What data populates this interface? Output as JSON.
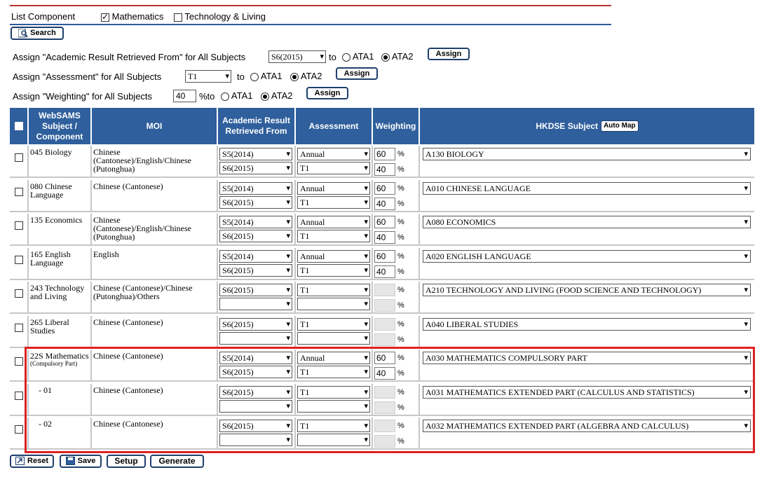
{
  "top": {
    "title": "List Component",
    "opt1": "Mathematics",
    "opt2": "Technology & Living",
    "search": "Search"
  },
  "assign": {
    "row1_label": "Assign \"Academic Result Retrieved From\" for All Subjects",
    "row1_select": "S6(2015)",
    "row2_label": "Assign \"Assessment\" for All Subjects",
    "row2_select": "T1",
    "row3_label": "Assign \"Weighting\" for All Subjects",
    "row3_value": "40",
    "to": "to",
    "pct_to": "%to",
    "ata1": "ATA1",
    "ata2": "ATA2",
    "assign_btn": "Assign"
  },
  "table": {
    "headers": {
      "subject": "WebSAMS Subject / Component",
      "moi": "MOI",
      "academic": "Academic Result Retrieved From",
      "assessment": "Assessment",
      "weighting": "Weighting",
      "hkdse": "HKDSE Subject",
      "automap": "Auto Map"
    },
    "rows": [
      {
        "subject": "045 Biology",
        "moi": "Chinese (Cantonese)/English/Chinese (Putonghua)",
        "ar1": "S5(2014)",
        "ar2": "S6(2015)",
        "as1": "Annual",
        "as2": "T1",
        "w1": "60",
        "w2": "40",
        "hk": "A130 BIOLOGY"
      },
      {
        "subject": "080 Chinese Language",
        "moi": "Chinese (Cantonese)",
        "ar1": "S5(2014)",
        "ar2": "S6(2015)",
        "as1": "Annual",
        "as2": "T1",
        "w1": "60",
        "w2": "40",
        "hk": "A010 CHINESE LANGUAGE"
      },
      {
        "subject": "135 Economics",
        "moi": "Chinese (Cantonese)/English/Chinese (Putonghua)",
        "ar1": "S5(2014)",
        "ar2": "S6(2015)",
        "as1": "Annual",
        "as2": "T1",
        "w1": "60",
        "w2": "40",
        "hk": "A080 ECONOMICS"
      },
      {
        "subject": "165 English Language",
        "moi": "English",
        "ar1": "S5(2014)",
        "ar2": "S6(2015)",
        "as1": "Annual",
        "as2": "T1",
        "w1": "60",
        "w2": "40",
        "hk": "A020 ENGLISH LANGUAGE"
      },
      {
        "subject": "243 Technology and Living",
        "moi": "Chinese (Cantonese)/Chinese (Putonghua)/Others",
        "ar1": "S6(2015)",
        "ar2": "",
        "as1": "T1",
        "as2": "",
        "w1": "",
        "w2": "",
        "hk": "A210 TECHNOLOGY AND LIVING (FOOD SCIENCE AND TECHNOLOGY)"
      },
      {
        "subject": "265 Liberal Studies",
        "moi": "Chinese (Cantonese)",
        "ar1": "S6(2015)",
        "ar2": "",
        "as1": "T1",
        "as2": "",
        "w1": "",
        "w2": "",
        "hk": "A040 LIBERAL STUDIES"
      },
      {
        "subject": "22S Mathematics",
        "subject_note": "(Compulsory Part)",
        "moi": "Chinese (Cantonese)",
        "ar1": "S5(2014)",
        "ar2": "S6(2015)",
        "as1": "Annual",
        "as2": "T1",
        "w1": "60",
        "w2": "40",
        "hk": "A030 MATHEMATICS COMPULSORY PART"
      },
      {
        "subject": "- 01",
        "moi": "Chinese (Cantonese)",
        "ar1": "S6(2015)",
        "ar2": "",
        "as1": "T1",
        "as2": "",
        "w1": "",
        "w2": "",
        "hk": "A031 MATHEMATICS EXTENDED PART (CALCULUS AND STATISTICS)"
      },
      {
        "subject": "- 02",
        "moi": "Chinese (Cantonese)",
        "ar1": "S6(2015)",
        "ar2": "",
        "as1": "T1",
        "as2": "",
        "w1": "",
        "w2": "",
        "hk": "A032 MATHEMATICS EXTENDED PART (ALGEBRA AND CALCULUS)"
      }
    ],
    "pct": "%"
  },
  "footer": {
    "reset": "Reset",
    "save": "Save",
    "setup": "Setup",
    "generate": "Generate"
  }
}
